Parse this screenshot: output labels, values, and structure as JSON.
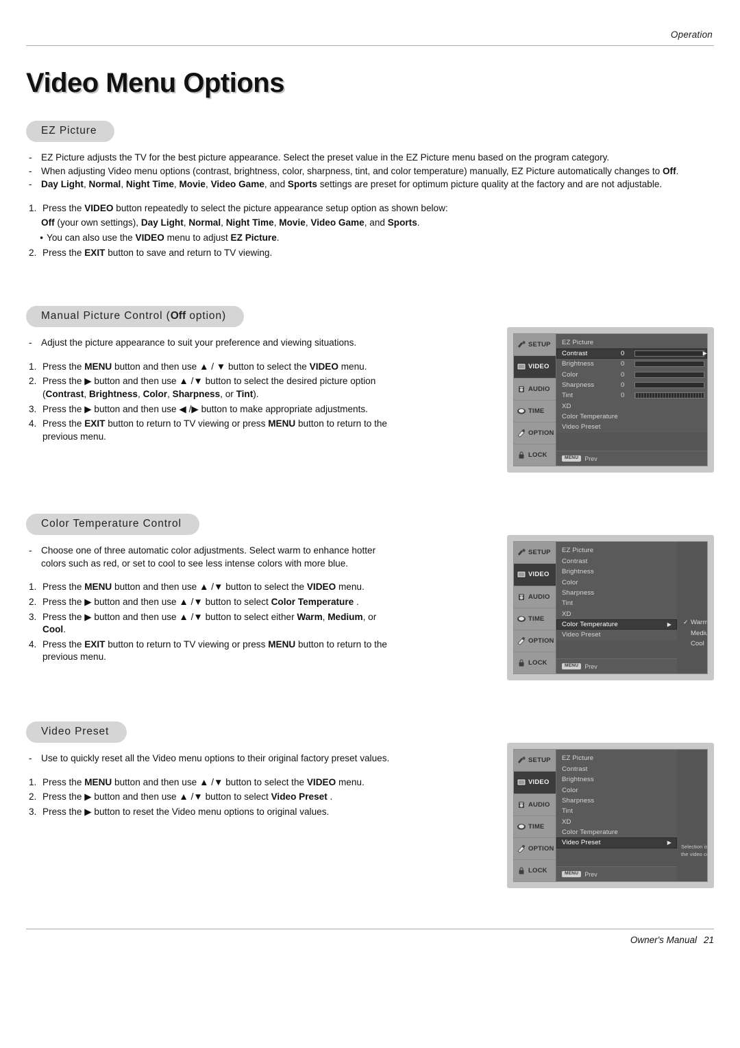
{
  "header": {
    "running_head": "Operation"
  },
  "page_title": "Video Menu Options",
  "sections": {
    "ez_picture": {
      "pill_label": "EZ Picture",
      "bullets": [
        {
          "marker": "-",
          "parts": [
            {
              "t": "EZ Picture adjusts the TV for the best picture appearance. Select the preset value in the EZ Picture menu based on the program category.",
              "b": false
            }
          ]
        },
        {
          "marker": "-",
          "parts": [
            {
              "t": "When adjusting Video menu options (contrast, brightness, color, sharpness, tint, and color temperature) manually, EZ Picture automatically changes to ",
              "b": false
            },
            {
              "t": "Off",
              "b": true
            },
            {
              "t": ".",
              "b": false
            }
          ]
        },
        {
          "marker": "-",
          "parts": [
            {
              "t": "Day Light",
              "b": true
            },
            {
              "t": ", ",
              "b": false
            },
            {
              "t": "Normal",
              "b": true
            },
            {
              "t": ", ",
              "b": false
            },
            {
              "t": "Night Time",
              "b": true
            },
            {
              "t": ", ",
              "b": false
            },
            {
              "t": "Movie",
              "b": true
            },
            {
              "t": ", ",
              "b": false
            },
            {
              "t": "Video Game",
              "b": true
            },
            {
              "t": ", and ",
              "b": false
            },
            {
              "t": "Sports",
              "b": true
            },
            {
              "t": " settings are preset for optimum picture quality at the factory and are not adjustable.",
              "b": false
            }
          ]
        }
      ],
      "steps": [
        {
          "marker": "1.",
          "parts": [
            {
              "t": "Press the ",
              "b": false
            },
            {
              "t": "VIDEO",
              "b": true
            },
            {
              "t": " button repeatedly to select the picture appearance setup option as shown below:",
              "b": false
            }
          ]
        },
        {
          "marker": "",
          "parts": [
            {
              "t": "Off",
              "b": true
            },
            {
              "t": " (your own settings), ",
              "b": false
            },
            {
              "t": "Day Light",
              "b": true
            },
            {
              "t": ", ",
              "b": false
            },
            {
              "t": "Normal",
              "b": true
            },
            {
              "t": ", ",
              "b": false
            },
            {
              "t": "Night Time",
              "b": true
            },
            {
              "t": ", ",
              "b": false
            },
            {
              "t": "Movie",
              "b": true
            },
            {
              "t": ", ",
              "b": false
            },
            {
              "t": "Video Game",
              "b": true
            },
            {
              "t": ", and ",
              "b": false
            },
            {
              "t": "Sports",
              "b": true
            },
            {
              "t": ".",
              "b": false
            }
          ]
        },
        {
          "marker": "•",
          "parts": [
            {
              "t": "You can also use the ",
              "b": false
            },
            {
              "t": "VIDEO",
              "b": true
            },
            {
              "t": " menu to adjust ",
              "b": false
            },
            {
              "t": "EZ Picture",
              "b": true
            },
            {
              "t": ".",
              "b": false
            }
          ]
        },
        {
          "marker": "2.",
          "parts": [
            {
              "t": "Press the ",
              "b": false
            },
            {
              "t": "EXIT",
              "b": true
            },
            {
              "t": " button to save and return to TV viewing.",
              "b": false
            }
          ]
        }
      ]
    },
    "manual_picture_control": {
      "pill_prefix": "Manual Picture Control (",
      "pill_bold": "Off",
      "pill_suffix": " option)",
      "bullets": [
        {
          "marker": "-",
          "parts": [
            {
              "t": "Adjust the picture appearance to suit your preference and viewing situations.",
              "b": false
            }
          ]
        }
      ],
      "steps": [
        {
          "marker": "1.",
          "parts": [
            {
              "t": "Press the ",
              "b": false
            },
            {
              "t": "MENU",
              "b": true
            },
            {
              "t": " button and then use ▲ / ▼ button to select the ",
              "b": false
            },
            {
              "t": "VIDEO",
              "b": true
            },
            {
              "t": " menu.",
              "b": false
            }
          ]
        },
        {
          "marker": "2.",
          "parts": [
            {
              "t": "Press the ▶ button and then use ▲ /▼ button to select the desired picture option (",
              "b": false
            },
            {
              "t": "Contrast",
              "b": true
            },
            {
              "t": ", ",
              "b": false
            },
            {
              "t": "Brightness",
              "b": true
            },
            {
              "t": ", ",
              "b": false
            },
            {
              "t": "Color",
              "b": true
            },
            {
              "t": ", ",
              "b": false
            },
            {
              "t": "Sharpness",
              "b": true
            },
            {
              "t": ", or ",
              "b": false
            },
            {
              "t": "Tint",
              "b": true
            },
            {
              "t": ").",
              "b": false
            }
          ]
        },
        {
          "marker": "3.",
          "parts": [
            {
              "t": "Press the ▶ button and then use ◀ /▶ button to make appropriate adjustments.",
              "b": false
            }
          ]
        },
        {
          "marker": "4.",
          "parts": [
            {
              "t": "Press the ",
              "b": false
            },
            {
              "t": "EXIT",
              "b": true
            },
            {
              "t": " button to return to TV viewing or press ",
              "b": false
            },
            {
              "t": "MENU",
              "b": true
            },
            {
              "t": " button to return to the previous menu.",
              "b": false
            }
          ]
        }
      ]
    },
    "color_temperature_control": {
      "pill_label": "Color Temperature Control",
      "bullets": [
        {
          "marker": "-",
          "parts": [
            {
              "t": "Choose one of three automatic color adjustments. Select warm to enhance hotter colors such as red, or set to cool to see less intense colors with more blue.",
              "b": false
            }
          ]
        }
      ],
      "steps": [
        {
          "marker": "1.",
          "parts": [
            {
              "t": "Press the ",
              "b": false
            },
            {
              "t": "MENU",
              "b": true
            },
            {
              "t": " button and then use ▲ /▼ button to select the ",
              "b": false
            },
            {
              "t": "VIDEO",
              "b": true
            },
            {
              "t": " menu.",
              "b": false
            }
          ]
        },
        {
          "marker": "2.",
          "parts": [
            {
              "t": "Press the ▶ button and then use ▲ /▼ button to select ",
              "b": false
            },
            {
              "t": "Color Temperature",
              "b": true
            },
            {
              "t": " .",
              "b": false
            }
          ]
        },
        {
          "marker": "3.",
          "parts": [
            {
              "t": "Press the ▶ button and then use ▲ /▼ button to select either ",
              "b": false
            },
            {
              "t": "Warm",
              "b": true
            },
            {
              "t": ", ",
              "b": false
            },
            {
              "t": "Medium",
              "b": true
            },
            {
              "t": ", or ",
              "b": false
            },
            {
              "t": "Cool",
              "b": true
            },
            {
              "t": ".",
              "b": false
            }
          ]
        },
        {
          "marker": "4.",
          "parts": [
            {
              "t": "Press the ",
              "b": false
            },
            {
              "t": "EXIT",
              "b": true
            },
            {
              "t": " button to return to TV viewing or press ",
              "b": false
            },
            {
              "t": "MENU",
              "b": true
            },
            {
              "t": " button to return to the previous menu.",
              "b": false
            }
          ]
        }
      ]
    },
    "video_preset": {
      "pill_label": "Video Preset",
      "bullets": [
        {
          "marker": "-",
          "parts": [
            {
              "t": "Use to quickly reset all the Video menu options to their original factory preset values.",
              "b": false
            }
          ]
        }
      ],
      "steps": [
        {
          "marker": "1.",
          "parts": [
            {
              "t": "Press the ",
              "b": false
            },
            {
              "t": "MENU",
              "b": true
            },
            {
              "t": " button and then use ▲ /▼ button to select the ",
              "b": false
            },
            {
              "t": "VIDEO",
              "b": true
            },
            {
              "t": " menu.",
              "b": false
            }
          ]
        },
        {
          "marker": "2.",
          "parts": [
            {
              "t": "Press the ▶ button and then use ▲ /▼ button to select ",
              "b": false
            },
            {
              "t": "Video Preset",
              "b": true
            },
            {
              "t": " .",
              "b": false
            }
          ]
        },
        {
          "marker": "3.",
          "parts": [
            {
              "t": "Press the ▶ button to reset the Video menu options to original values.",
              "b": false
            }
          ]
        }
      ]
    }
  },
  "osd": {
    "sidebar": [
      {
        "label": "SETUP",
        "icon": "setup-icon",
        "selected": false
      },
      {
        "label": "VIDEO",
        "icon": "video-icon",
        "selected": true
      },
      {
        "label": "AUDIO",
        "icon": "audio-icon",
        "selected": false
      },
      {
        "label": "TIME",
        "icon": "time-icon",
        "selected": false
      },
      {
        "label": "OPTION",
        "icon": "option-icon",
        "selected": false
      },
      {
        "label": "LOCK",
        "icon": "lock-icon",
        "selected": false
      }
    ],
    "menu_badge": "MENU",
    "prev_label": "Prev",
    "screen1": {
      "rows": [
        {
          "label": "EZ Picture",
          "value": "",
          "bar": "none",
          "highlight": false
        },
        {
          "label": "Contrast",
          "value": "0",
          "bar": "solid",
          "highlight": true
        },
        {
          "label": "Brightness",
          "value": "0",
          "bar": "solid",
          "highlight": false
        },
        {
          "label": "Color",
          "value": "0",
          "bar": "solid",
          "highlight": false
        },
        {
          "label": "Sharpness",
          "value": "0",
          "bar": "solid",
          "highlight": false
        },
        {
          "label": "Tint",
          "value": "0",
          "bar": "ticks",
          "highlight": false
        },
        {
          "label": "XD",
          "value": "",
          "bar": "none",
          "highlight": false
        },
        {
          "label": "Color Temperature",
          "value": "",
          "bar": "none",
          "highlight": false
        },
        {
          "label": "Video Preset",
          "value": "",
          "bar": "none",
          "highlight": false
        }
      ]
    },
    "screen2": {
      "rows": [
        {
          "label": "EZ Picture",
          "highlight": false,
          "arrow": false
        },
        {
          "label": "Contrast",
          "highlight": false,
          "arrow": false
        },
        {
          "label": "Brightness",
          "highlight": false,
          "arrow": false
        },
        {
          "label": "Color",
          "highlight": false,
          "arrow": false
        },
        {
          "label": "Sharpness",
          "highlight": false,
          "arrow": false
        },
        {
          "label": "Tint",
          "highlight": false,
          "arrow": false
        },
        {
          "label": "XD",
          "highlight": false,
          "arrow": false
        },
        {
          "label": "Color Temperature",
          "highlight": true,
          "arrow": true
        },
        {
          "label": "Video Preset",
          "highlight": false,
          "arrow": false
        }
      ],
      "options": [
        {
          "label": "Warm",
          "checked": true
        },
        {
          "label": "Medium",
          "checked": false
        },
        {
          "label": "Cool",
          "checked": false
        }
      ]
    },
    "screen3": {
      "rows": [
        {
          "label": "EZ Picture",
          "highlight": false,
          "arrow": false
        },
        {
          "label": "Contrast",
          "highlight": false,
          "arrow": false
        },
        {
          "label": "Brightness",
          "highlight": false,
          "arrow": false
        },
        {
          "label": "Color",
          "highlight": false,
          "arrow": false
        },
        {
          "label": "Sharpness",
          "highlight": false,
          "arrow": false
        },
        {
          "label": "Tint",
          "highlight": false,
          "arrow": false
        },
        {
          "label": "XD",
          "highlight": false,
          "arrow": false
        },
        {
          "label": "Color Temperature",
          "highlight": false,
          "arrow": false
        },
        {
          "label": "Video Preset",
          "highlight": true,
          "arrow": true
        }
      ],
      "help_line1": "Selection is or of presets",
      "help_line2": "the video configuration"
    }
  },
  "footer": {
    "manual_label": "Owner's Manual",
    "page_number": "21"
  }
}
